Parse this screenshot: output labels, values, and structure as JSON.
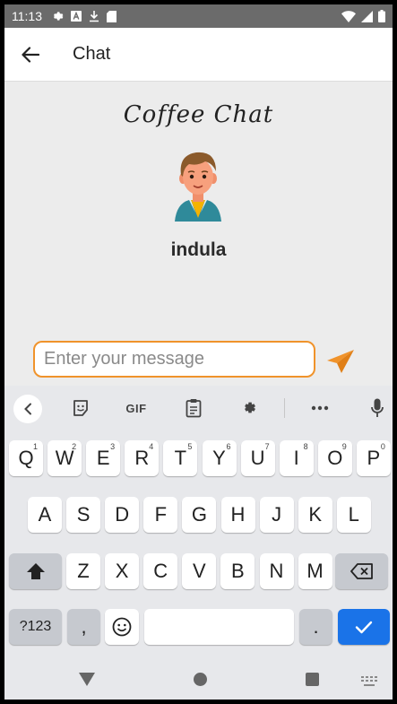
{
  "status_bar": {
    "time": "11:13"
  },
  "app_bar": {
    "title": "Chat"
  },
  "content": {
    "brand": "Coffee Chat",
    "username": "indula"
  },
  "composer": {
    "placeholder": "Enter your message",
    "accent": "#f0932b"
  },
  "keyboard": {
    "toolbar": {
      "gif_label": "GIF"
    },
    "row1": [
      {
        "label": "Q",
        "sub": "1"
      },
      {
        "label": "W",
        "sub": "2"
      },
      {
        "label": "E",
        "sub": "3"
      },
      {
        "label": "R",
        "sub": "4"
      },
      {
        "label": "T",
        "sub": "5"
      },
      {
        "label": "Y",
        "sub": "6"
      },
      {
        "label": "U",
        "sub": "7"
      },
      {
        "label": "I",
        "sub": "8"
      },
      {
        "label": "O",
        "sub": "9"
      },
      {
        "label": "P",
        "sub": "0"
      }
    ],
    "row2": [
      "A",
      "S",
      "D",
      "F",
      "G",
      "H",
      "J",
      "K",
      "L"
    ],
    "row3": [
      "Z",
      "X",
      "C",
      "V",
      "B",
      "N",
      "M"
    ],
    "row4": {
      "symbols_label": "?123",
      "comma_label": ",",
      "period_label": "."
    },
    "enter_color": "#1a73e8"
  }
}
